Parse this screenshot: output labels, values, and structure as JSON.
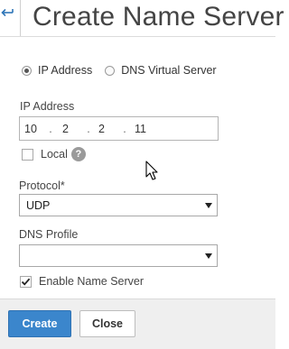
{
  "header": {
    "back_icon": "back-arrow-icon",
    "title": "Create Name Server"
  },
  "type_selector": {
    "options": [
      {
        "label": "IP Address",
        "selected": true
      },
      {
        "label": "DNS Virtual Server",
        "selected": false
      }
    ]
  },
  "ip_address": {
    "label": "IP Address",
    "octets": [
      "10",
      "2",
      "2",
      "11"
    ],
    "separator": "."
  },
  "local": {
    "label": "Local",
    "checked": false,
    "help_glyph": "?"
  },
  "protocol": {
    "label": "Protocol*",
    "value": "UDP"
  },
  "dns_profile": {
    "label": "DNS Profile",
    "value": ""
  },
  "enable_name_server": {
    "label": "Enable Name Server",
    "checked": true
  },
  "footer": {
    "create_label": "Create",
    "close_label": "Close"
  },
  "colors": {
    "accent": "#3b86cc",
    "back_icon": "#2f76b8"
  }
}
